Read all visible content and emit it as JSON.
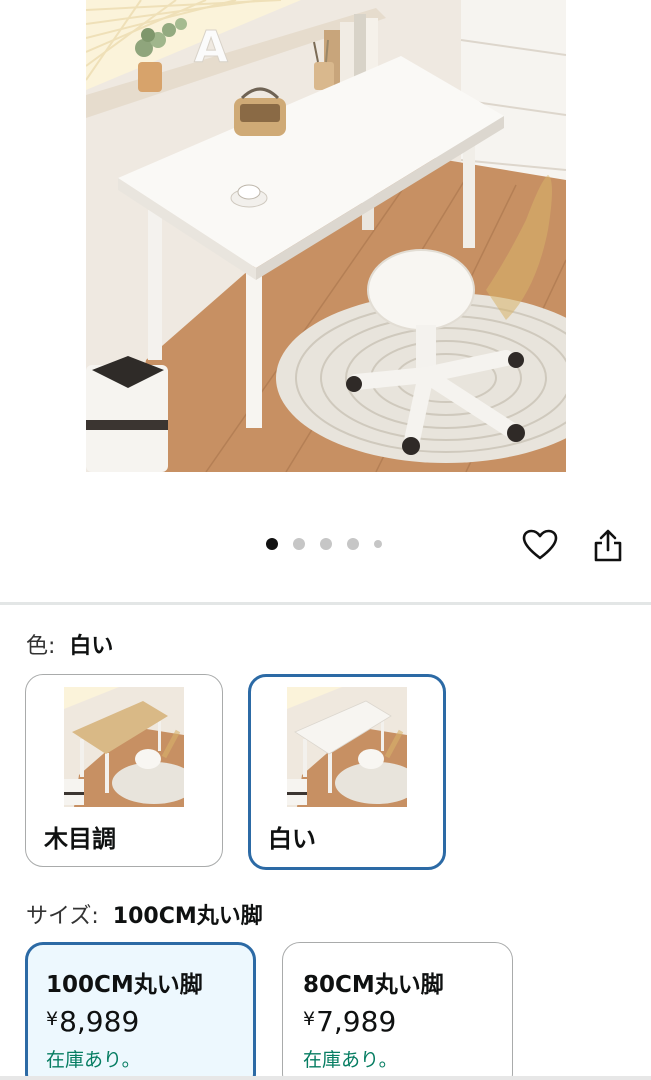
{
  "product_image": {
    "alt": "白いデスクと椅子",
    "carousel_count": 5,
    "carousel_active_index": 0
  },
  "actions": {
    "favorite_icon": "heart-outline-icon",
    "share_icon": "share-icon"
  },
  "color": {
    "label": "色:",
    "selected_value": "白い",
    "options": [
      {
        "label": "木目調",
        "selected": false,
        "desk_top_color": "#d9b986"
      },
      {
        "label": "白い",
        "selected": true,
        "desk_top_color": "#f7f5f1"
      }
    ]
  },
  "size": {
    "label": "サイズ:",
    "selected_value": "100CM丸い脚",
    "options": [
      {
        "label": "100CM丸い脚",
        "currency": "¥",
        "price": "8,989",
        "stock": "在庫あり。",
        "selected": true
      },
      {
        "label": "80CM丸い脚",
        "currency": "¥",
        "price": "7,989",
        "stock": "在庫あり。",
        "selected": false
      }
    ]
  },
  "colors": {
    "accent_selected_border": "#2c6aa5",
    "selected_background": "#edf8fe",
    "in_stock_text": "#067d62",
    "unselected_border": "#a9abab"
  }
}
